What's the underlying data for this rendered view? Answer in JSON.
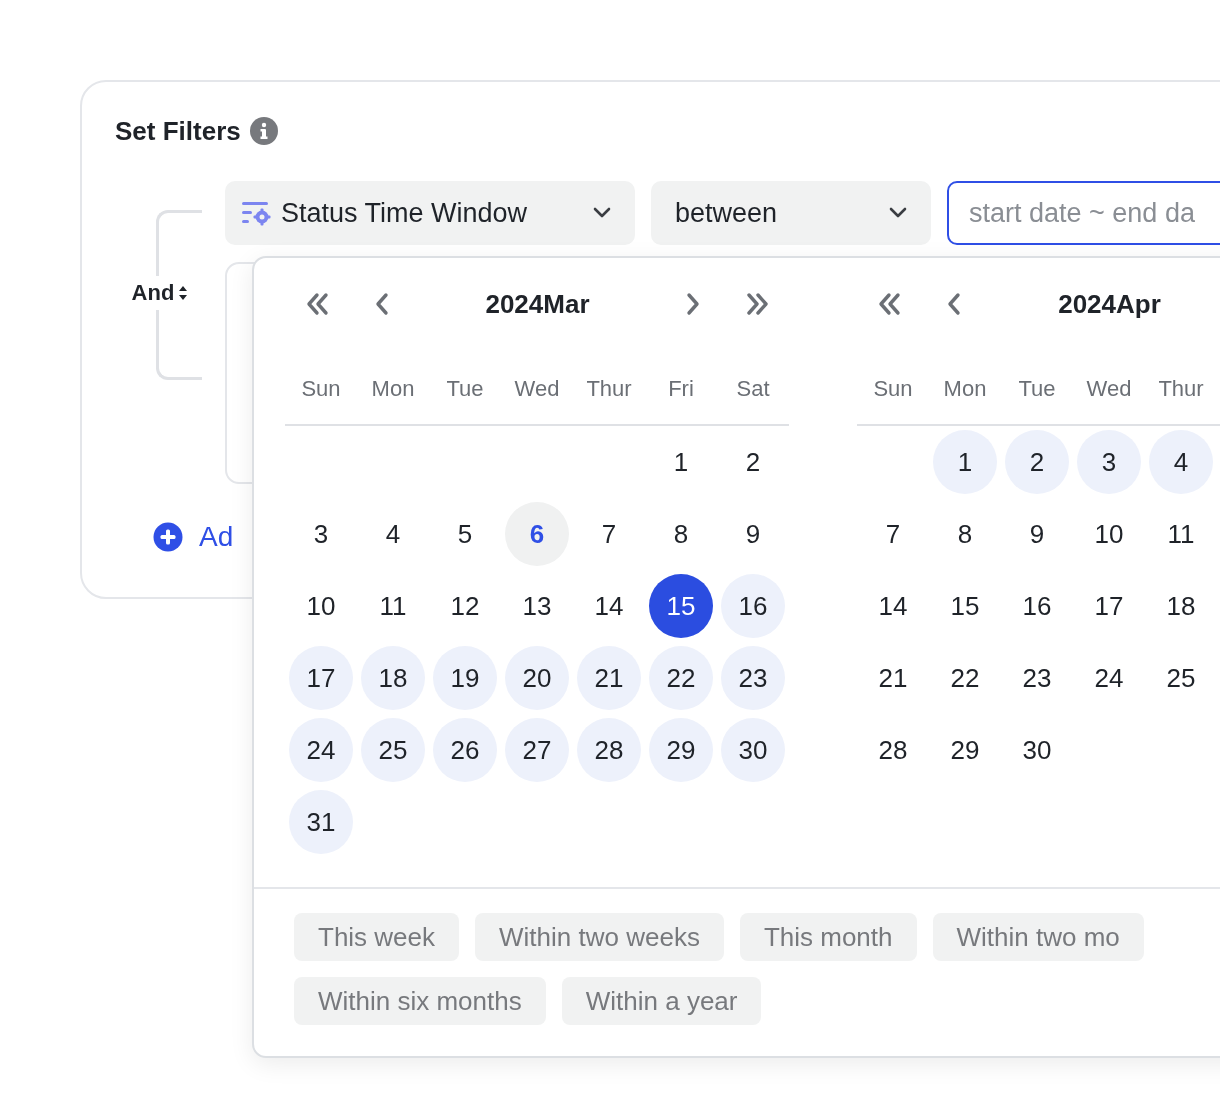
{
  "title": "Set Filters",
  "logic": {
    "label": "And"
  },
  "filter": {
    "field": "Status Time Window",
    "operator": "between",
    "date_range": {
      "placeholder": "start date ~ end da",
      "focused": true
    }
  },
  "add_button": {
    "label": "Ad"
  },
  "calendars": [
    {
      "title": "2024Mar",
      "weekdays": [
        "Sun",
        "Mon",
        "Tue",
        "Wed",
        "Thur",
        "Fri",
        "Sat"
      ],
      "weeks": [
        [
          {
            "kind": "blank"
          },
          {
            "kind": "blank"
          },
          {
            "kind": "blank"
          },
          {
            "kind": "blank"
          },
          {
            "kind": "blank"
          },
          {
            "kind": "day",
            "day": "1",
            "today": false,
            "selected": false,
            "in_range": false
          },
          {
            "kind": "day",
            "day": "2",
            "today": false,
            "selected": false,
            "in_range": false
          }
        ],
        [
          {
            "kind": "day",
            "day": "3",
            "today": false,
            "selected": false,
            "in_range": false
          },
          {
            "kind": "day",
            "day": "4",
            "today": false,
            "selected": false,
            "in_range": false
          },
          {
            "kind": "day",
            "day": "5",
            "today": false,
            "selected": false,
            "in_range": false
          },
          {
            "kind": "day",
            "day": "6",
            "today": true,
            "selected": false,
            "in_range": false
          },
          {
            "kind": "day",
            "day": "7",
            "today": false,
            "selected": false,
            "in_range": false
          },
          {
            "kind": "day",
            "day": "8",
            "today": false,
            "selected": false,
            "in_range": false
          },
          {
            "kind": "day",
            "day": "9",
            "today": false,
            "selected": false,
            "in_range": false
          }
        ],
        [
          {
            "kind": "day",
            "day": "10",
            "today": false,
            "selected": false,
            "in_range": false
          },
          {
            "kind": "day",
            "day": "11",
            "today": false,
            "selected": false,
            "in_range": false
          },
          {
            "kind": "day",
            "day": "12",
            "today": false,
            "selected": false,
            "in_range": false
          },
          {
            "kind": "day",
            "day": "13",
            "today": false,
            "selected": false,
            "in_range": false
          },
          {
            "kind": "day",
            "day": "14",
            "today": false,
            "selected": false,
            "in_range": false
          },
          {
            "kind": "day",
            "day": "15",
            "today": false,
            "selected": true,
            "in_range": false
          },
          {
            "kind": "day",
            "day": "16",
            "today": false,
            "selected": false,
            "in_range": true
          }
        ],
        [
          {
            "kind": "day",
            "day": "17",
            "today": false,
            "selected": false,
            "in_range": true
          },
          {
            "kind": "day",
            "day": "18",
            "today": false,
            "selected": false,
            "in_range": true
          },
          {
            "kind": "day",
            "day": "19",
            "today": false,
            "selected": false,
            "in_range": true
          },
          {
            "kind": "day",
            "day": "20",
            "today": false,
            "selected": false,
            "in_range": true
          },
          {
            "kind": "day",
            "day": "21",
            "today": false,
            "selected": false,
            "in_range": true
          },
          {
            "kind": "day",
            "day": "22",
            "today": false,
            "selected": false,
            "in_range": true
          },
          {
            "kind": "day",
            "day": "23",
            "today": false,
            "selected": false,
            "in_range": true
          }
        ],
        [
          {
            "kind": "day",
            "day": "24",
            "today": false,
            "selected": false,
            "in_range": true
          },
          {
            "kind": "day",
            "day": "25",
            "today": false,
            "selected": false,
            "in_range": true
          },
          {
            "kind": "day",
            "day": "26",
            "today": false,
            "selected": false,
            "in_range": true
          },
          {
            "kind": "day",
            "day": "27",
            "today": false,
            "selected": false,
            "in_range": true
          },
          {
            "kind": "day",
            "day": "28",
            "today": false,
            "selected": false,
            "in_range": true
          },
          {
            "kind": "day",
            "day": "29",
            "today": false,
            "selected": false,
            "in_range": true
          },
          {
            "kind": "day",
            "day": "30",
            "today": false,
            "selected": false,
            "in_range": true
          }
        ],
        [
          {
            "kind": "day",
            "day": "31",
            "today": false,
            "selected": false,
            "in_range": true
          }
        ]
      ]
    },
    {
      "title": "2024Apr",
      "weekdays": [
        "Sun",
        "Mon",
        "Tue",
        "Wed",
        "Thur"
      ],
      "weeks": [
        [
          {
            "kind": "blank"
          },
          {
            "kind": "day",
            "day": "1",
            "today": false,
            "selected": false,
            "in_range": true
          },
          {
            "kind": "day",
            "day": "2",
            "today": false,
            "selected": false,
            "in_range": true
          },
          {
            "kind": "day",
            "day": "3",
            "today": false,
            "selected": false,
            "in_range": true
          },
          {
            "kind": "day",
            "day": "4",
            "today": false,
            "selected": false,
            "in_range": true
          }
        ],
        [
          {
            "kind": "day",
            "day": "7",
            "today": false,
            "selected": false,
            "in_range": false
          },
          {
            "kind": "day",
            "day": "8",
            "today": false,
            "selected": false,
            "in_range": false
          },
          {
            "kind": "day",
            "day": "9",
            "today": false,
            "selected": false,
            "in_range": false
          },
          {
            "kind": "day",
            "day": "10",
            "today": false,
            "selected": false,
            "in_range": false
          },
          {
            "kind": "day",
            "day": "11",
            "today": false,
            "selected": false,
            "in_range": false
          }
        ],
        [
          {
            "kind": "day",
            "day": "14",
            "today": false,
            "selected": false,
            "in_range": false
          },
          {
            "kind": "day",
            "day": "15",
            "today": false,
            "selected": false,
            "in_range": false
          },
          {
            "kind": "day",
            "day": "16",
            "today": false,
            "selected": false,
            "in_range": false
          },
          {
            "kind": "day",
            "day": "17",
            "today": false,
            "selected": false,
            "in_range": false
          },
          {
            "kind": "day",
            "day": "18",
            "today": false,
            "selected": false,
            "in_range": false
          }
        ],
        [
          {
            "kind": "day",
            "day": "21",
            "today": false,
            "selected": false,
            "in_range": false
          },
          {
            "kind": "day",
            "day": "22",
            "today": false,
            "selected": false,
            "in_range": false
          },
          {
            "kind": "day",
            "day": "23",
            "today": false,
            "selected": false,
            "in_range": false
          },
          {
            "kind": "day",
            "day": "24",
            "today": false,
            "selected": false,
            "in_range": false
          },
          {
            "kind": "day",
            "day": "25",
            "today": false,
            "selected": false,
            "in_range": false
          }
        ],
        [
          {
            "kind": "day",
            "day": "28",
            "today": false,
            "selected": false,
            "in_range": false
          },
          {
            "kind": "day",
            "day": "29",
            "today": false,
            "selected": false,
            "in_range": false
          },
          {
            "kind": "day",
            "day": "30",
            "today": false,
            "selected": false,
            "in_range": false
          }
        ]
      ]
    }
  ],
  "presets": [
    [
      "This week",
      "Within two weeks",
      "This month",
      "Within two mo"
    ],
    [
      "Within six months",
      "Within a year"
    ]
  ]
}
